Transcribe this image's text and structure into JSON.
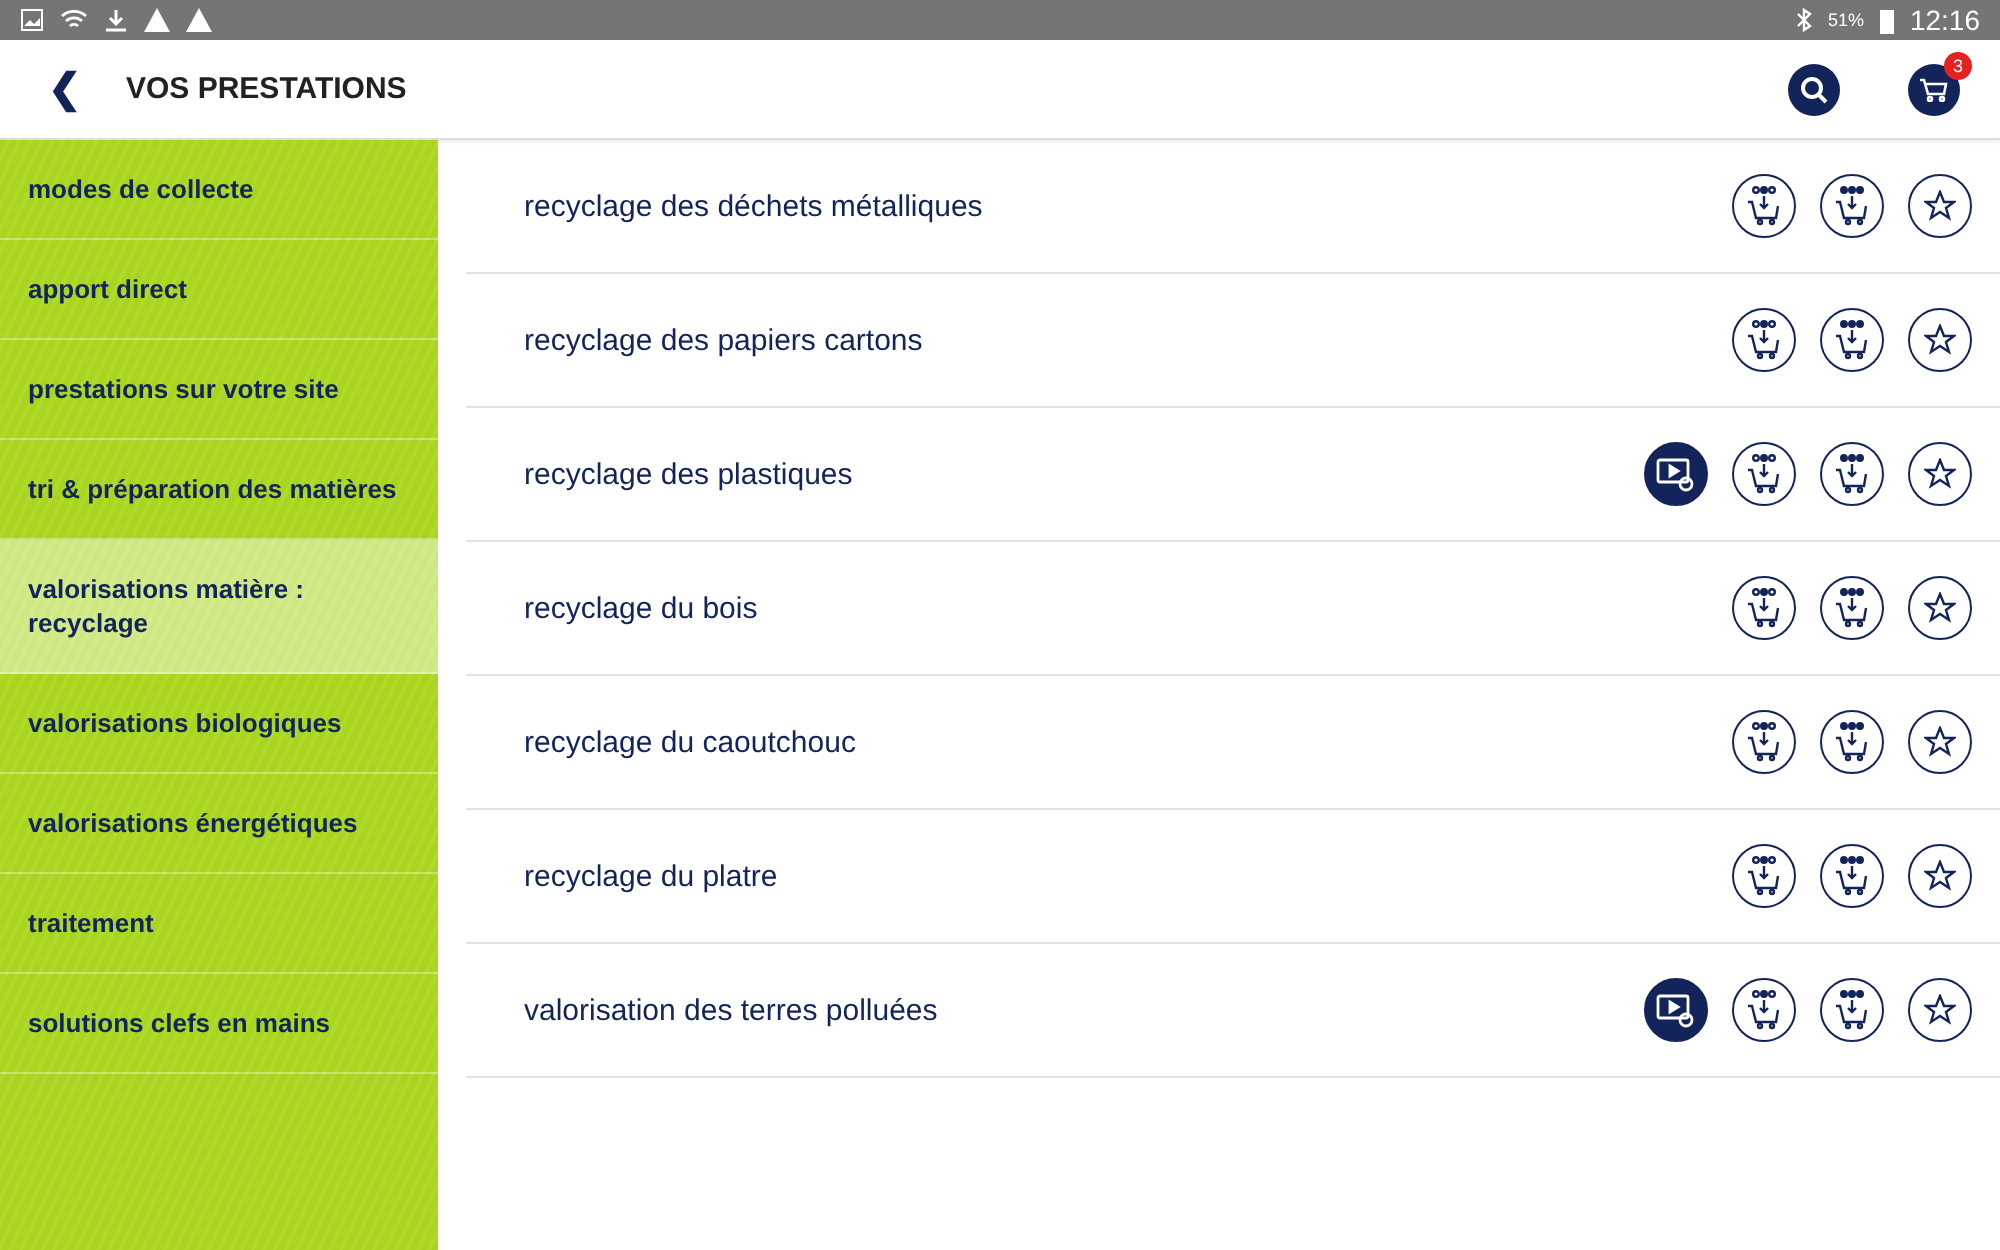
{
  "status_bar": {
    "battery": "51%",
    "time": "12:16"
  },
  "header": {
    "back": "❮",
    "title": "VOS PRESTATIONS",
    "cart_count": "3"
  },
  "sidebar": {
    "items": [
      {
        "label": "modes de collecte",
        "selected": false
      },
      {
        "label": "apport direct",
        "selected": false
      },
      {
        "label": "prestations sur votre site",
        "selected": false
      },
      {
        "label": "tri & préparation des matières",
        "selected": false
      },
      {
        "label": "valorisations matière : recyclage",
        "selected": true
      },
      {
        "label": "valorisations biologiques",
        "selected": false
      },
      {
        "label": "valorisations énergétiques",
        "selected": false
      },
      {
        "label": "traitement",
        "selected": false
      },
      {
        "label": "solutions clefs en mains",
        "selected": false
      }
    ]
  },
  "services": [
    {
      "label": "recyclage des déchets métalliques",
      "video": false
    },
    {
      "label": "recyclage des papiers cartons",
      "video": false
    },
    {
      "label": "recyclage des plastiques",
      "video": true
    },
    {
      "label": "recyclage du bois",
      "video": false
    },
    {
      "label": "recyclage du caoutchouc",
      "video": false
    },
    {
      "label": "recyclage du platre",
      "video": false
    },
    {
      "label": "valorisation des terres polluées",
      "video": true
    }
  ]
}
